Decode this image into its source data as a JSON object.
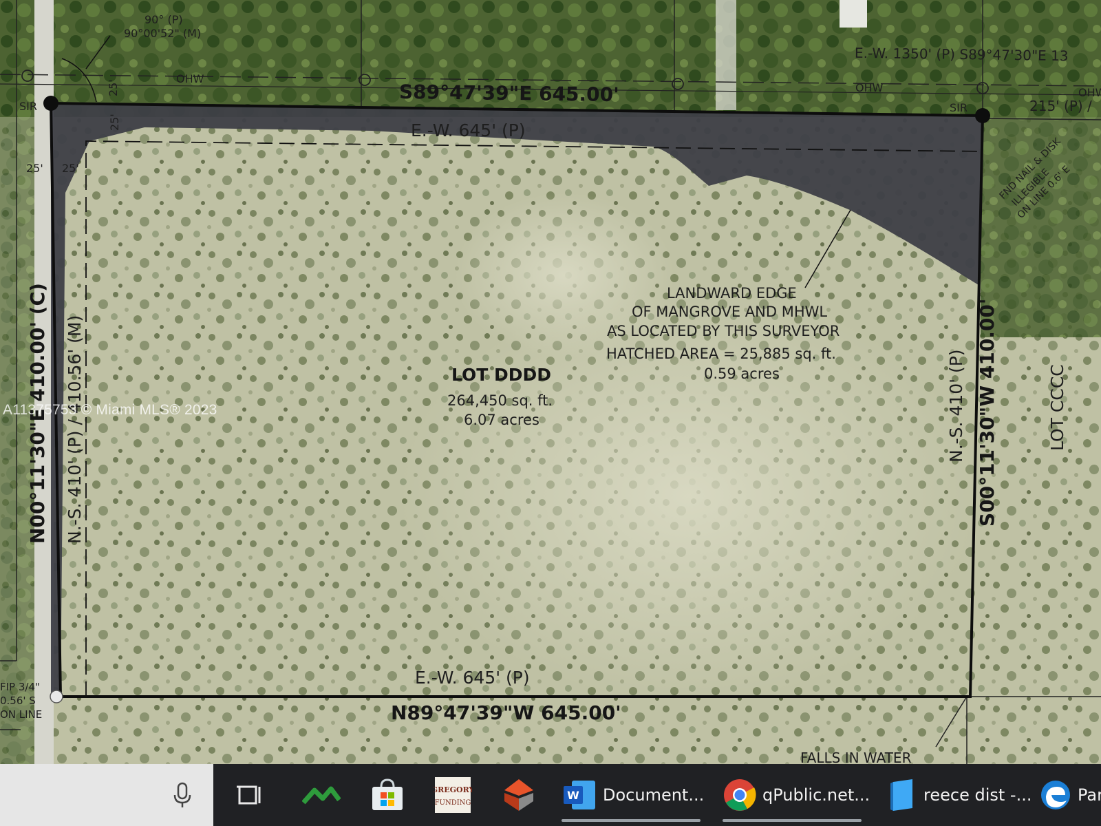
{
  "survey": {
    "lot_name": "LOT DDDD",
    "lot_area_sqft": "264,450 sq. ft.",
    "lot_area_acres": "6.07 acres",
    "north_bearing": "S89°47'39\"E 645.00'",
    "south_bearing": "N89°47'39\"W 645.00'",
    "west_bearing": "N00°11'30\"E 410.00' (C)",
    "east_bearing": "S00°11'30\"W 410.00'",
    "north_plat": "E.-W. 645' (P)",
    "south_plat": "E.-W. 645' (P)",
    "west_plat": "N.-S. 410' (P) / 410.56' (M)",
    "east_plat": "N.-S. 410' (P)",
    "mangrove_note": [
      "LANDWARD EDGE",
      "OF MANGROVE AND MHWL",
      "AS LOCATED BY THIS SURVEYOR"
    ],
    "hatched_area": "HATCHED AREA = 25,885 sq. ft.",
    "hatched_acres": "0.59 acres",
    "neighbor_lot": "LOT CCCC",
    "angle_plat": "90° (P)",
    "angle_measured": "90°00'52\" (M)",
    "top_right_bearing": "E.-W. 1350' (P) S89°47'30\"E 13",
    "top_right_plat": "215' (P) /",
    "ohw_label": "OHW",
    "sir_label": "SIR",
    "setback": "25'",
    "fip_note": [
      "FIP 3/4\"",
      "0.56' S",
      "ON LINE"
    ],
    "found_nail_note": [
      "FND NAIL & DISK",
      "ILLEGIBLE",
      "ON LINE 0.6' E"
    ],
    "falls_in_water": "FALLS IN WATER"
  },
  "watermark": "A11375753 © Miami MLS® 2023",
  "taskbar": {
    "apps": [
      {
        "name": "word",
        "label": "Document..."
      },
      {
        "name": "chrome",
        "label": "qPublic.net..."
      },
      {
        "name": "reece",
        "label": "reece dist -..."
      },
      {
        "name": "edge",
        "label": "Par"
      }
    ],
    "gregory_logo": "GREGORY FUNDING"
  }
}
